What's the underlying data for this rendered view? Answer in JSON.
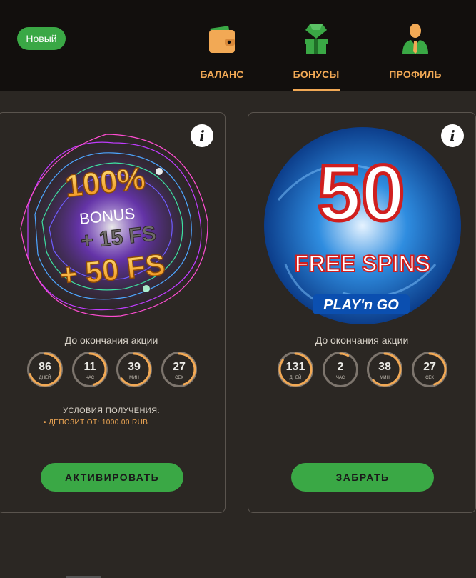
{
  "header": {
    "badge": "Новый",
    "nav": [
      {
        "label": "БАЛАНС",
        "icon": "wallet-icon",
        "active": false
      },
      {
        "label": "БОНУСЫ",
        "icon": "gift-diamond-icon",
        "active": true
      },
      {
        "label": "ПРОФИЛЬ",
        "icon": "user-icon",
        "active": false
      }
    ]
  },
  "colors": {
    "accent": "#f2a955",
    "green": "#3aa845",
    "background": "#2b2723",
    "header_bg": "#120f0d"
  },
  "cards": [
    {
      "art": {
        "line1": "100%",
        "line2": "BONUS",
        "line3": "+ 15 FS",
        "line4": "+ 50 FS"
      },
      "until_label": "До окончания акции",
      "timer": [
        {
          "value": "86",
          "unit": "ДНЕЙ",
          "progress": 0.7
        },
        {
          "value": "11",
          "unit": "ЧАС",
          "progress": 0.46
        },
        {
          "value": "39",
          "unit": "МИН",
          "progress": 0.65
        },
        {
          "value": "27",
          "unit": "СЕК",
          "progress": 0.45
        }
      ],
      "conditions_title": "УСЛОВИЯ ПОЛУЧЕНИЯ:",
      "conditions_item": "• ДЕПОЗИТ ОТ: 1000.00 RUB",
      "button": "АКТИВИРОВАТЬ"
    },
    {
      "art": {
        "line1": "50",
        "line2": "FREE SPINS",
        "brand": "PLAY'n GO"
      },
      "until_label": "До окончания акции",
      "timer": [
        {
          "value": "131",
          "unit": "ДНЕЙ",
          "progress": 0.85
        },
        {
          "value": "2",
          "unit": "ЧАС",
          "progress": 0.08
        },
        {
          "value": "38",
          "unit": "МИН",
          "progress": 0.63
        },
        {
          "value": "27",
          "unit": "СЕК",
          "progress": 0.45
        }
      ],
      "button": "ЗАБРАТЬ"
    }
  ]
}
